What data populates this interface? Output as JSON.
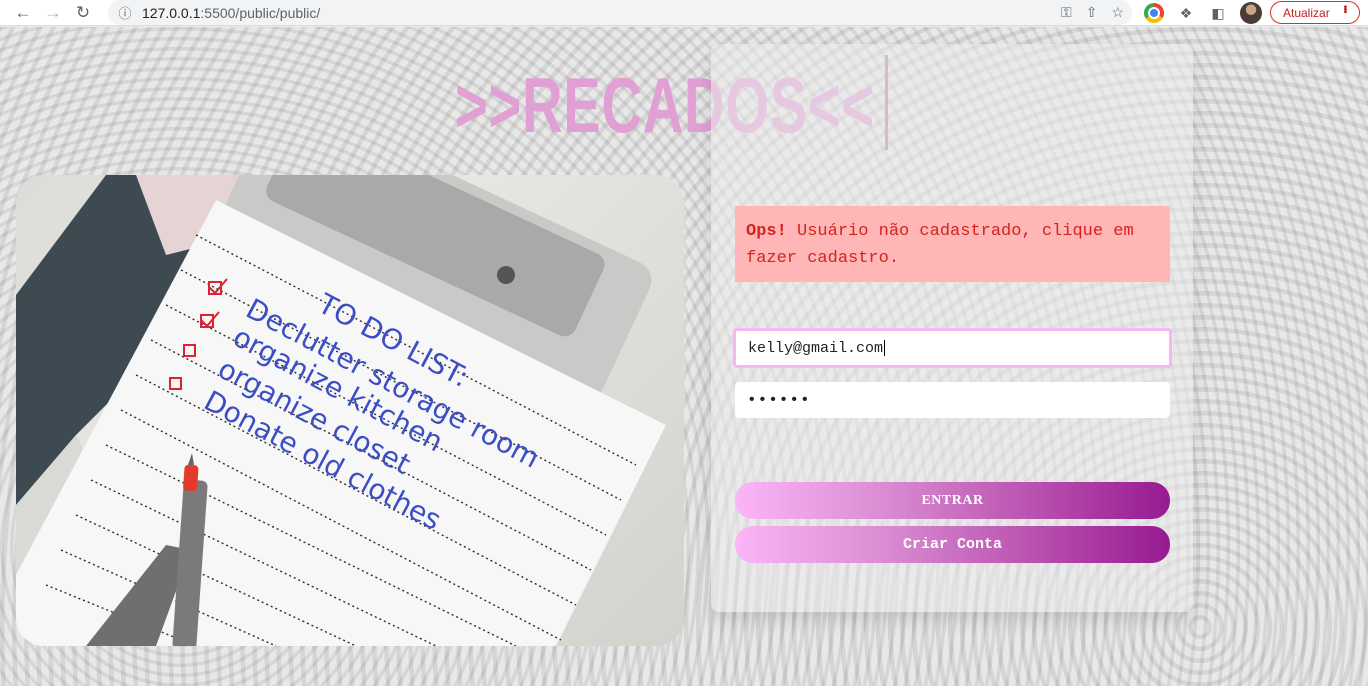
{
  "browser": {
    "url_host": "127.0.0.1",
    "url_rest": ":5500/public/public/",
    "update_label": "Atualizar"
  },
  "page": {
    "title": ">>RECADOS<<",
    "photo": {
      "note_lines": [
        "TO DO LIST:",
        "Declutter storage room",
        "organize kitchen",
        "organize closet",
        "Donate old clothes"
      ]
    },
    "alert": {
      "strong": "Ops!",
      "message": " Usuário não cadastrado, clique em fazer cadastro."
    },
    "form": {
      "email_value": "kelly@gmail.com",
      "password_mask": "••••••",
      "enter_label": "ENTRAR",
      "create_label": "Criar Conta"
    }
  }
}
